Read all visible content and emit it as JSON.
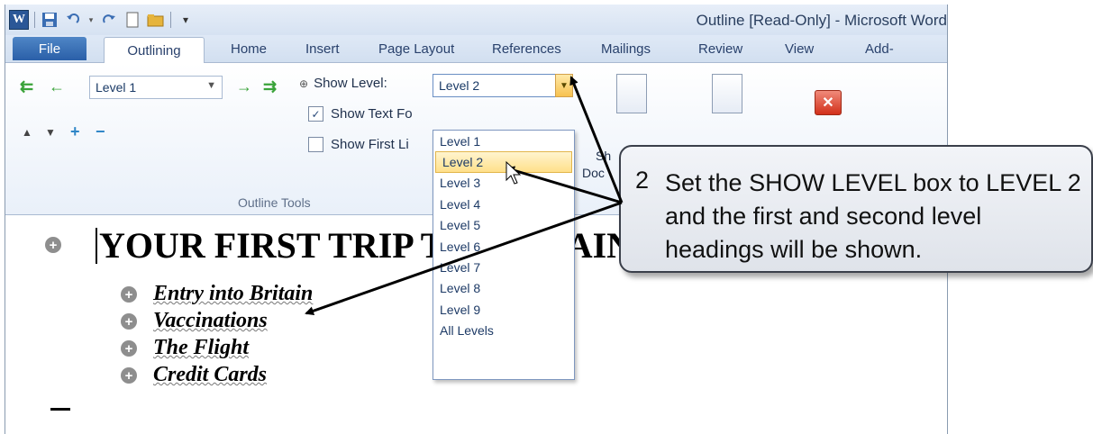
{
  "window": {
    "title": "Outline [Read-Only] - Microsoft Word"
  },
  "qat": {
    "icons": [
      "word-logo",
      "save-icon",
      "undo-icon",
      "redo-icon",
      "new-doc-icon",
      "open-folder-icon",
      "customize-icon"
    ],
    "logo_letter": "W"
  },
  "tabs": [
    "File",
    "Outlining",
    "Home",
    "Insert",
    "Page Layout",
    "References",
    "Mailings",
    "Review",
    "View",
    "Add-"
  ],
  "ribbon": {
    "level_box": "Level 1",
    "show_level_label": "Show Level:",
    "show_level_value": "Level 2",
    "show_text_formatting": "Show Text Fo",
    "show_first_line": "Show First Li",
    "show_text_formatting_checked": true,
    "show_first_line_checked": false,
    "group_label": "Outline Tools",
    "show_document_partial": "Sh",
    "show_document_partial2": "Doc"
  },
  "dropdown": {
    "items": [
      "Level 1",
      "Level 2",
      "Level 3",
      "Level 4",
      "Level 5",
      "Level 6",
      "Level 7",
      "Level 8",
      "Level 9",
      "All Levels"
    ],
    "selected": "Level 2"
  },
  "document": {
    "heading1": "YOUR FIRST TRIP TO BRITAIN",
    "headings2": [
      "Entry into Britain",
      "Vaccinations",
      "The Flight",
      "Credit Cards"
    ]
  },
  "callout": {
    "number": "2",
    "text": "Set the SHOW LEVEL box to LEVEL 2 and the first and second level headings will be shown."
  }
}
